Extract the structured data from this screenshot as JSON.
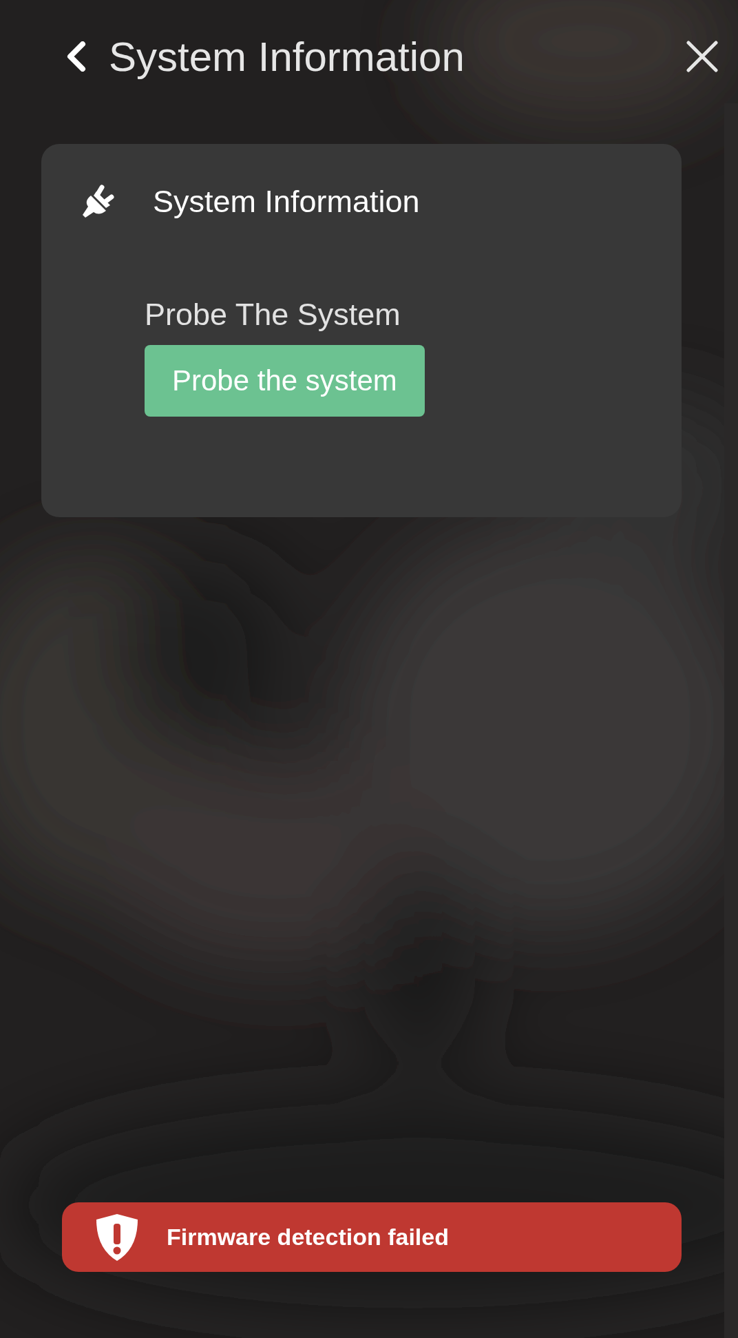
{
  "header": {
    "title": "System Information"
  },
  "card": {
    "title": "System Information",
    "section_label": "Probe The System",
    "button": "Probe the system"
  },
  "toast": {
    "message": "Firmware detection failed"
  }
}
